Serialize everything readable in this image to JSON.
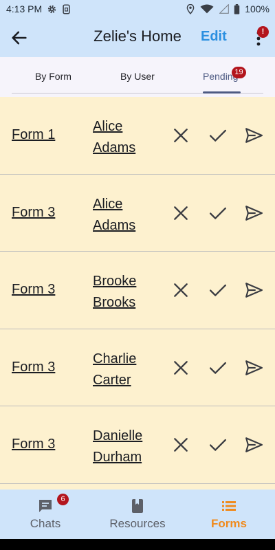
{
  "status_bar": {
    "time": "4:13 PM",
    "battery": "100%"
  },
  "app_bar": {
    "title": "Zelie's Home",
    "edit_label": "Edit",
    "alert_badge": "!"
  },
  "tabs": [
    {
      "label": "By Form"
    },
    {
      "label": "By User"
    },
    {
      "label": "Pending",
      "badge": "19",
      "active": true
    }
  ],
  "rows": [
    {
      "form": "Form 1",
      "user": "Alice Adams"
    },
    {
      "form": "Form 3",
      "user": "Alice Adams"
    },
    {
      "form": "Form 3",
      "user": "Brooke Brooks"
    },
    {
      "form": "Form 3",
      "user": "Charlie Carter"
    },
    {
      "form": "Form 3",
      "user": "Danielle Durham"
    }
  ],
  "bottom_nav": {
    "items": [
      {
        "label": "Chats",
        "icon": "chat-icon",
        "badge": "6"
      },
      {
        "label": "Resources",
        "icon": "book-icon"
      },
      {
        "label": "Forms",
        "icon": "list-icon",
        "active": true
      }
    ]
  },
  "colors": {
    "bar_background": "#cfe4fa",
    "row_background": "#fdf1cf",
    "accent_blue": "#2a8fe0",
    "active_nav": "#f08a1c",
    "badge_red": "#b3151d"
  }
}
